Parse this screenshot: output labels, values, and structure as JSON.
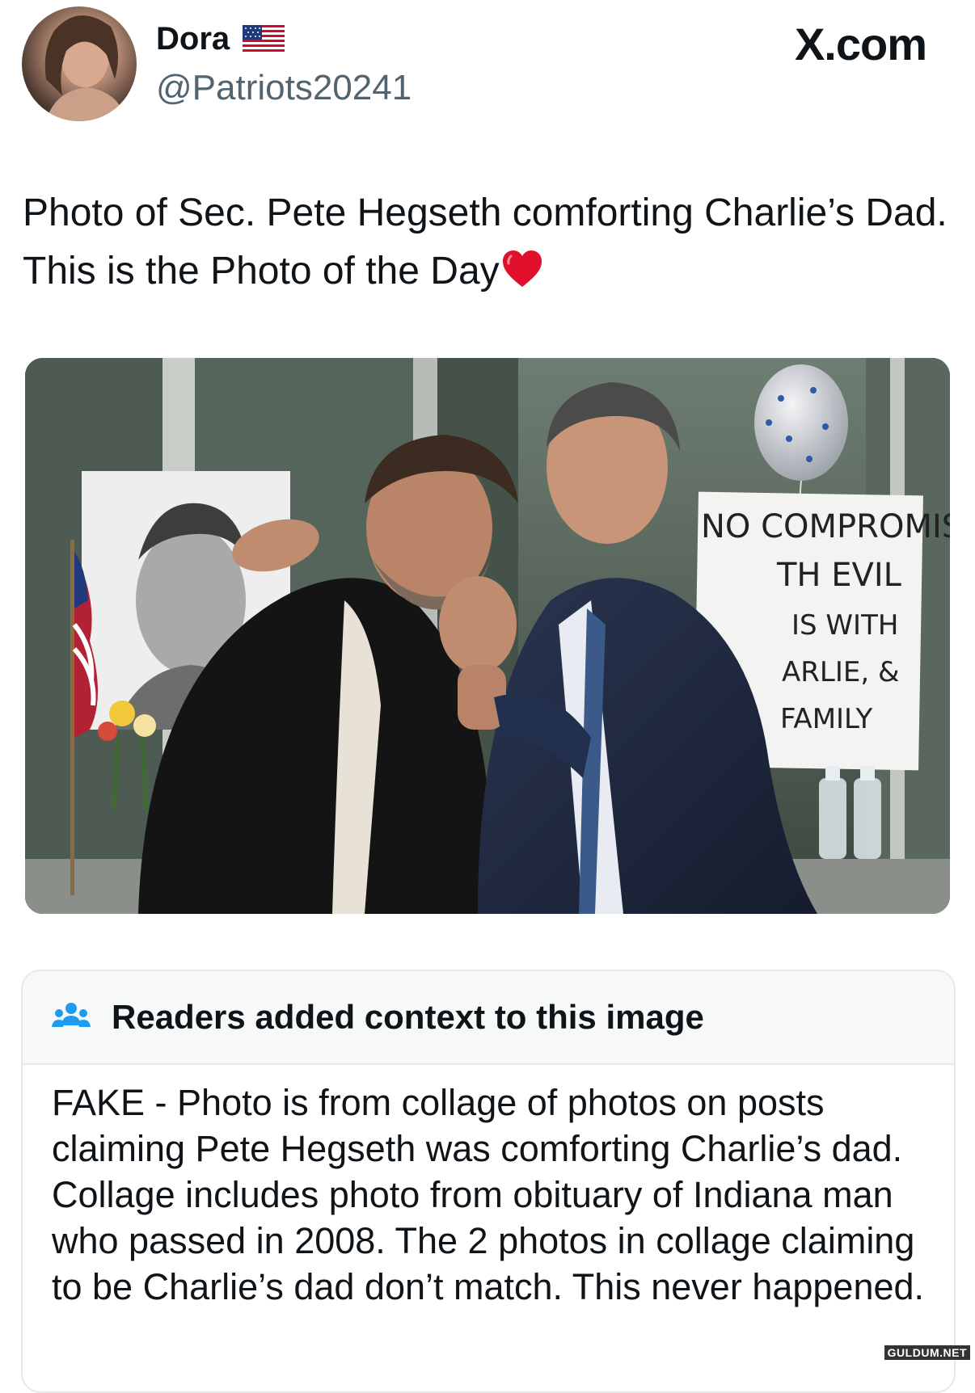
{
  "author": {
    "display_name": "Dora",
    "flag": "us-flag-icon",
    "handle": "@Patriots20241",
    "site": "X.com"
  },
  "tweet": {
    "text": "Photo of Sec. Pete Hegseth comforting Charlie’s Dad.  This is the Photo of the Day"
  },
  "media": {
    "sign_lines": [
      "NO COMPROMISE",
      "TH EVIL",
      "IS WITH",
      "ARLIE, &",
      "FAMILY"
    ]
  },
  "community_note": {
    "title": "Readers added context to this image",
    "icon": "people-icon",
    "body": "FAKE - Photo is from collage of photos on posts claiming Pete Hegseth was comforting Charlie’s dad. Collage includes photo from obituary of Indiana man who passed in 2008. The 2 photos in collage claiming to be Charlie’s dad don’t match. This never happened."
  },
  "watermark": "GULDUM.NET",
  "colors": {
    "handle": "#536471",
    "note_icon": "#1d9bf0",
    "heart": "#e0102a"
  }
}
